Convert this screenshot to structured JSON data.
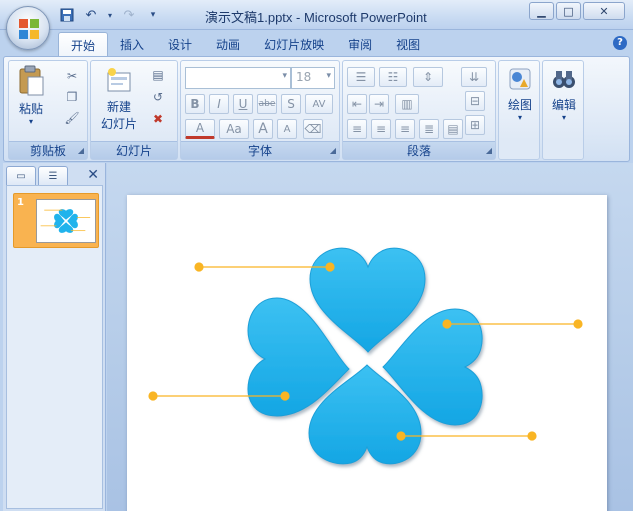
{
  "window": {
    "title": "演示文稿1.pptx - Microsoft PowerPoint",
    "minimize": "▁",
    "maximize": "□",
    "close": "✕"
  },
  "tabs": [
    {
      "label": "开始",
      "active": true
    },
    {
      "label": "插入"
    },
    {
      "label": "设计"
    },
    {
      "label": "动画"
    },
    {
      "label": "幻灯片放映"
    },
    {
      "label": "审阅"
    },
    {
      "label": "视图"
    }
  ],
  "help": "?",
  "groups": {
    "clipboard": {
      "label": "剪贴板",
      "paste": "粘贴"
    },
    "slides": {
      "label": "幻灯片",
      "new_slide_line1": "新建",
      "new_slide_line2": "幻灯片"
    },
    "font": {
      "label": "字体",
      "font_name": "",
      "font_size": "18"
    },
    "paragraph": {
      "label": "段落"
    },
    "drawing": {
      "label": "绘图"
    },
    "editing": {
      "label": "编辑"
    }
  },
  "format_buttons": [
    "B",
    "I",
    "U",
    "abe",
    "S",
    "AV",
    "A",
    "Aa",
    "A",
    "A"
  ],
  "slide_pane": {
    "slide_number": "1"
  },
  "colors": {
    "heart": "#20b3ec",
    "heart_light": "#5fcdf4",
    "connector": "#f9b524",
    "thumb_selected": "#f9b350"
  }
}
